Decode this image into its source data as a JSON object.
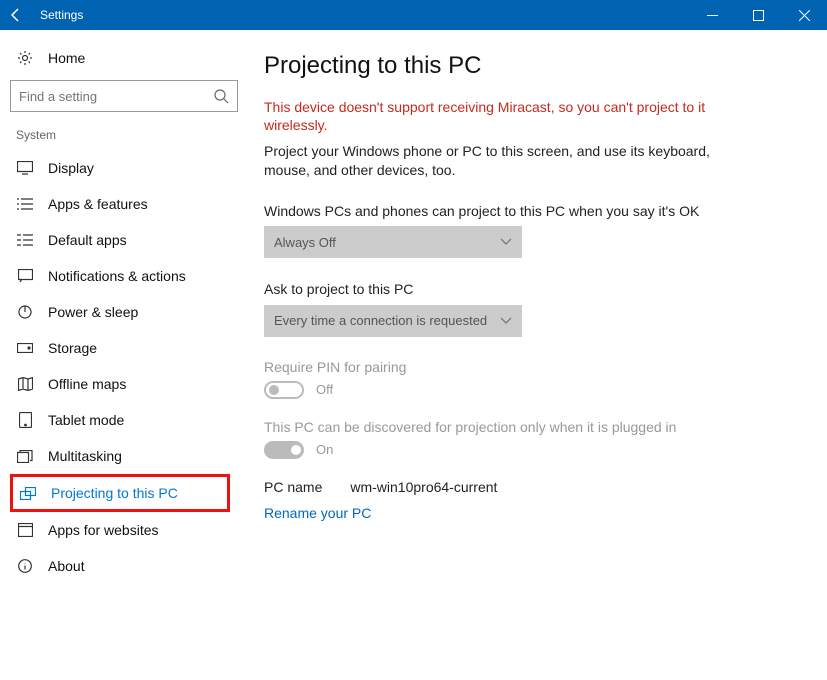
{
  "titlebar": {
    "title": "Settings"
  },
  "sidebar": {
    "home": "Home",
    "search_placeholder": "Find a setting",
    "group": "System",
    "items": [
      {
        "label": "Display"
      },
      {
        "label": "Apps & features"
      },
      {
        "label": "Default apps"
      },
      {
        "label": "Notifications & actions"
      },
      {
        "label": "Power & sleep"
      },
      {
        "label": "Storage"
      },
      {
        "label": "Offline maps"
      },
      {
        "label": "Tablet mode"
      },
      {
        "label": "Multitasking"
      },
      {
        "label": "Projecting to this PC"
      },
      {
        "label": "Apps for websites"
      },
      {
        "label": "About"
      }
    ]
  },
  "main": {
    "heading": "Projecting to this PC",
    "error": "This device doesn't support receiving Miracast, so you can't project to it wirelessly.",
    "desc": "Project your Windows phone or PC to this screen, and use its keyboard, mouse, and other devices, too.",
    "field1_label": "Windows PCs and phones can project to this PC when you say it's OK",
    "field1_value": "Always Off",
    "field2_label": "Ask to project to this PC",
    "field2_value": "Every time a connection is requested",
    "pin_label": "Require PIN for pairing",
    "pin_state": "Off",
    "discover_label": "This PC can be discovered for projection only when it is plugged in",
    "discover_state": "On",
    "pcname_label": "PC name",
    "pcname_value": "wm-win10pro64-current",
    "rename_link": "Rename your PC"
  }
}
